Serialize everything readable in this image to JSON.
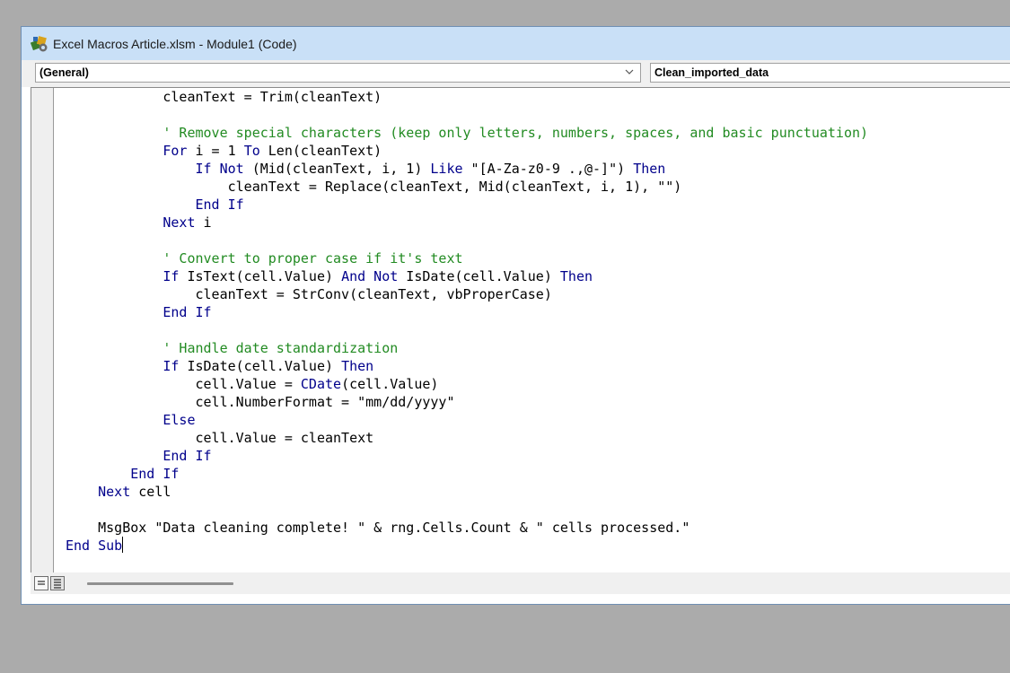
{
  "window": {
    "title": "Excel Macros Article.xlsm - Module1 (Code)",
    "icon": "vba-project-icon"
  },
  "toolbar": {
    "object_combo": "(General)",
    "procedure_combo": "Clean_imported_data"
  },
  "code": {
    "lines": [
      [
        {
          "t": "            cleanText = Trim(cleanText)",
          "c": ""
        }
      ],
      [
        {
          "t": "",
          "c": ""
        }
      ],
      [
        {
          "t": "            ' Remove special characters (keep only letters, numbers, spaces, and basic punctuation)",
          "c": "cm"
        }
      ],
      [
        {
          "t": "            ",
          "c": ""
        },
        {
          "t": "For",
          "c": "kw"
        },
        {
          "t": " i = 1 ",
          "c": ""
        },
        {
          "t": "To",
          "c": "kw"
        },
        {
          "t": " Len(cleanText)",
          "c": ""
        }
      ],
      [
        {
          "t": "                ",
          "c": ""
        },
        {
          "t": "If Not",
          "c": "kw"
        },
        {
          "t": " (Mid(cleanText, i, 1) ",
          "c": ""
        },
        {
          "t": "Like",
          "c": "kw"
        },
        {
          "t": " \"[A-Za-z0-9 .,@-]\") ",
          "c": ""
        },
        {
          "t": "Then",
          "c": "kw"
        }
      ],
      [
        {
          "t": "                    cleanText = Replace(cleanText, Mid(cleanText, i, 1), \"\")",
          "c": ""
        }
      ],
      [
        {
          "t": "                ",
          "c": ""
        },
        {
          "t": "End If",
          "c": "kw"
        }
      ],
      [
        {
          "t": "            ",
          "c": ""
        },
        {
          "t": "Next",
          "c": "kw"
        },
        {
          "t": " i",
          "c": ""
        }
      ],
      [
        {
          "t": "",
          "c": ""
        }
      ],
      [
        {
          "t": "            ' Convert to proper case if it's text",
          "c": "cm"
        }
      ],
      [
        {
          "t": "            ",
          "c": ""
        },
        {
          "t": "If",
          "c": "kw"
        },
        {
          "t": " IsText(cell.Value) ",
          "c": ""
        },
        {
          "t": "And Not",
          "c": "kw"
        },
        {
          "t": " IsDate(cell.Value) ",
          "c": ""
        },
        {
          "t": "Then",
          "c": "kw"
        }
      ],
      [
        {
          "t": "                cleanText = StrConv(cleanText, vbProperCase)",
          "c": ""
        }
      ],
      [
        {
          "t": "            ",
          "c": ""
        },
        {
          "t": "End If",
          "c": "kw"
        }
      ],
      [
        {
          "t": "",
          "c": ""
        }
      ],
      [
        {
          "t": "            ' Handle date standardization",
          "c": "cm"
        }
      ],
      [
        {
          "t": "            ",
          "c": ""
        },
        {
          "t": "If",
          "c": "kw"
        },
        {
          "t": " IsDate(cell.Value) ",
          "c": ""
        },
        {
          "t": "Then",
          "c": "kw"
        }
      ],
      [
        {
          "t": "                cell.Value = ",
          "c": ""
        },
        {
          "t": "CDate",
          "c": "kw"
        },
        {
          "t": "(cell.Value)",
          "c": ""
        }
      ],
      [
        {
          "t": "                cell.NumberFormat = \"mm/dd/yyyy\"",
          "c": ""
        }
      ],
      [
        {
          "t": "            ",
          "c": ""
        },
        {
          "t": "Else",
          "c": "kw"
        }
      ],
      [
        {
          "t": "                cell.Value = cleanText",
          "c": ""
        }
      ],
      [
        {
          "t": "            ",
          "c": ""
        },
        {
          "t": "End If",
          "c": "kw"
        }
      ],
      [
        {
          "t": "        ",
          "c": ""
        },
        {
          "t": "End If",
          "c": "kw"
        }
      ],
      [
        {
          "t": "    ",
          "c": ""
        },
        {
          "t": "Next",
          "c": "kw"
        },
        {
          "t": " cell",
          "c": ""
        }
      ],
      [
        {
          "t": "",
          "c": ""
        }
      ],
      [
        {
          "t": "    MsgBox \"Data cleaning complete! \" & rng.Cells.Count & \" cells processed.\"",
          "c": ""
        }
      ],
      [
        {
          "t": "",
          "c": ""
        },
        {
          "t": "End Sub",
          "c": "kw"
        }
      ]
    ]
  },
  "colors": {
    "keyword": "#00008b",
    "comment": "#228b22",
    "text": "#000000",
    "titlebar": "#c9e0f7"
  }
}
